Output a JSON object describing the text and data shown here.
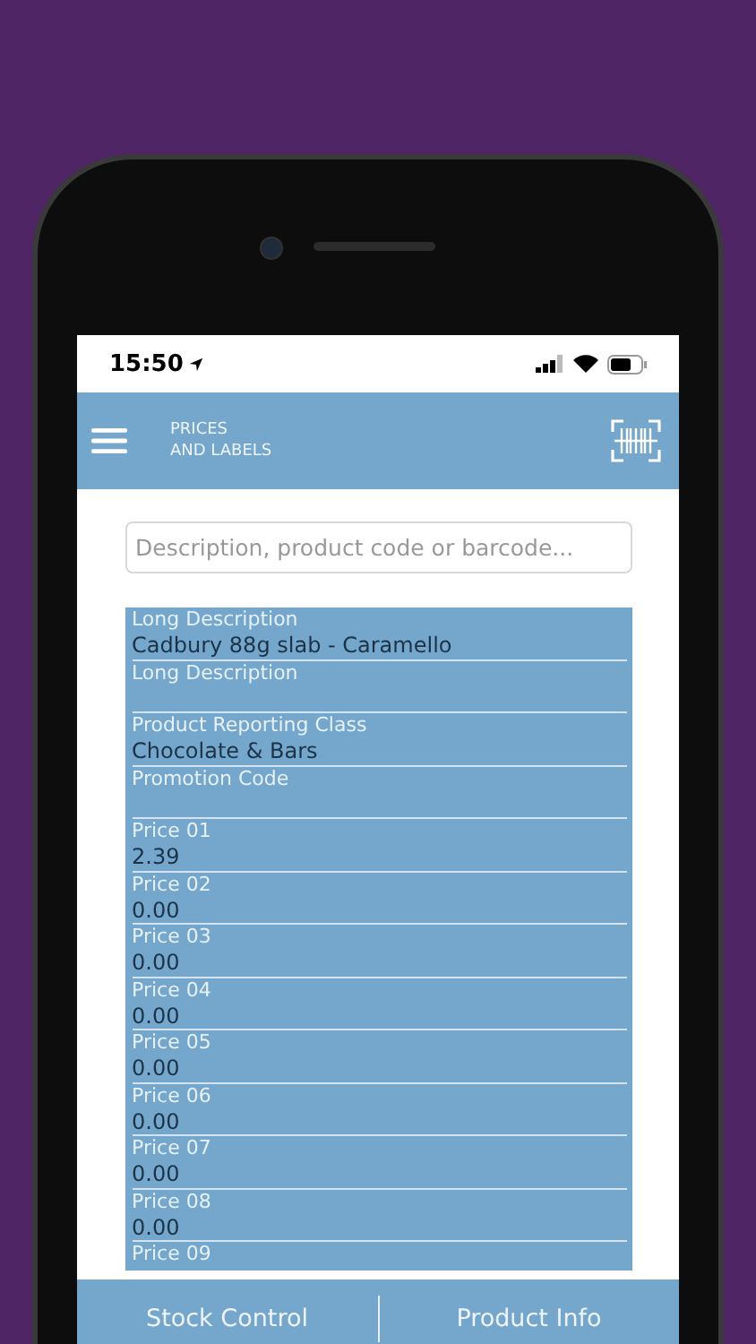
{
  "status_bar": {
    "time": "15:50"
  },
  "header": {
    "title_lines": [
      "PRICES",
      "AND LABELS"
    ]
  },
  "search": {
    "placeholder": "Description, product code or barcode..."
  },
  "fields": [
    {
      "label": "Long Description",
      "value": "Cadbury 88g slab - Caramello"
    },
    {
      "label": "Long Description"
    },
    {
      "label": "Product Reporting Class",
      "value": "Chocolate & Bars"
    },
    {
      "label": "Promotion Code"
    },
    {
      "label": "Price 01",
      "value": "2.39"
    },
    {
      "label": "Price 02",
      "value": "0.00"
    },
    {
      "label": "Price 03",
      "value": "0.00"
    },
    {
      "label": "Price 04",
      "value": "0.00"
    },
    {
      "label": "Price 05",
      "value": "0.00"
    },
    {
      "label": "Price 06",
      "value": "0.00"
    },
    {
      "label": "Price 07",
      "value": "0.00"
    },
    {
      "label": "Price 08",
      "value": "0.00"
    },
    {
      "label": "Price 09"
    }
  ],
  "bottom_nav": [
    "Stock Control",
    "Product Info"
  ]
}
